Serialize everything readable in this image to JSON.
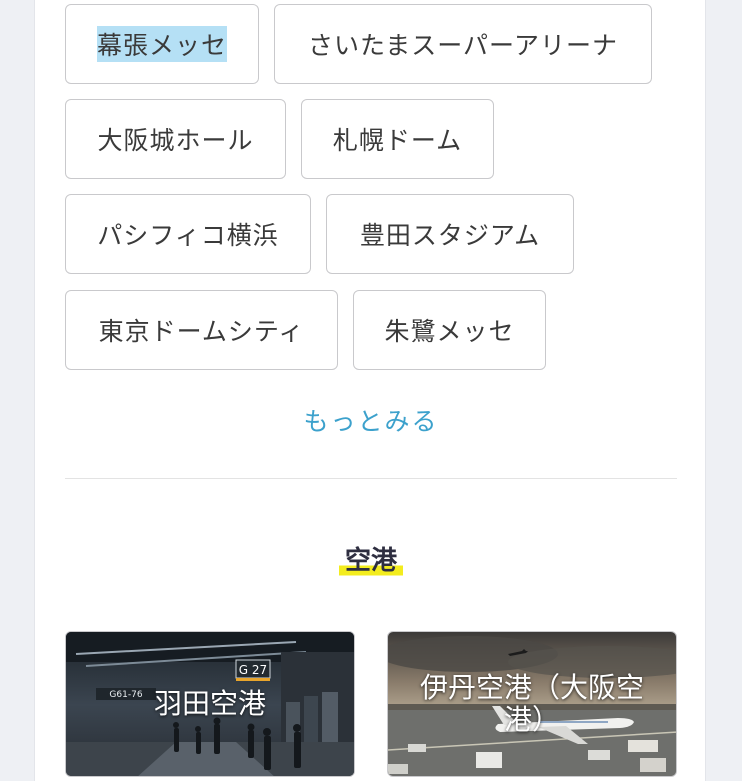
{
  "venues": [
    {
      "label": "幕張メッセ",
      "selected": true
    },
    {
      "label": "さいたまスーパーアリーナ"
    },
    {
      "label": "大阪城ホール"
    },
    {
      "label": "札幌ドーム"
    },
    {
      "label": "パシフィコ横浜"
    },
    {
      "label": "豊田スタジアム"
    },
    {
      "label": "東京ドームシティ"
    },
    {
      "label": "朱鷺メッセ"
    }
  ],
  "more_label": "もっとみる",
  "airports": {
    "heading": "空港",
    "cards": [
      {
        "title": "羽田空港",
        "sign_gate": "G 27",
        "sign_range": "G61-76"
      },
      {
        "title": "伊丹空港（大阪空港）"
      }
    ]
  },
  "colors": {
    "link": "#3ca1cc",
    "highlight": "#f3ec1e",
    "selection": "#b5e0f5"
  }
}
